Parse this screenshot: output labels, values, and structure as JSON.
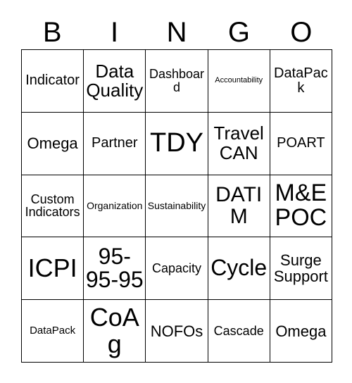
{
  "card": {
    "title": "BINGO",
    "header_letters": [
      "B",
      "I",
      "N",
      "G",
      "O"
    ],
    "grid_size": "5x5",
    "colors": {
      "text": "#000000",
      "border": "#000000",
      "background": "#ffffff"
    },
    "rows": [
      [
        {
          "text": "Indicator",
          "size": "fs-ml"
        },
        {
          "text": "Data Quality",
          "size": "fs-xl"
        },
        {
          "text": "Dashboard",
          "size": "fs-m"
        },
        {
          "text": "Accountability",
          "size": "fs-xs"
        },
        {
          "text": "DataPack",
          "size": "fs-ml"
        }
      ],
      [
        {
          "text": "Omega",
          "size": "fs-l"
        },
        {
          "text": "Partner",
          "size": "fs-ml"
        },
        {
          "text": "TDY",
          "size": "fs-6xl"
        },
        {
          "text": "Travel CAN",
          "size": "fs-xl"
        },
        {
          "text": "POART",
          "size": "fs-ml"
        }
      ],
      [
        {
          "text": "Custom Indicators",
          "size": "fs-m"
        },
        {
          "text": "Organization",
          "size": "fs-s"
        },
        {
          "text": "Sustainability",
          "size": "fs-s"
        },
        {
          "text": "DATIM",
          "size": "fs-xxl"
        },
        {
          "text": "M&E POC",
          "size": "fs-4xl"
        }
      ],
      [
        {
          "text": "ICPI",
          "size": "fs-5xl"
        },
        {
          "text": "95-95-95",
          "size": "fs-3xl"
        },
        {
          "text": "Capacity",
          "size": "fs-m"
        },
        {
          "text": "Cycle",
          "size": "fs-3xl"
        },
        {
          "text": "Surge Support",
          "size": "fs-l"
        }
      ],
      [
        {
          "text": "DataPack",
          "size": "fs-sm"
        },
        {
          "text": "CoAg",
          "size": "fs-5xl"
        },
        {
          "text": "NOFOs",
          "size": "fs-l"
        },
        {
          "text": "Cascade",
          "size": "fs-m"
        },
        {
          "text": "Omega",
          "size": "fs-l"
        }
      ]
    ]
  }
}
